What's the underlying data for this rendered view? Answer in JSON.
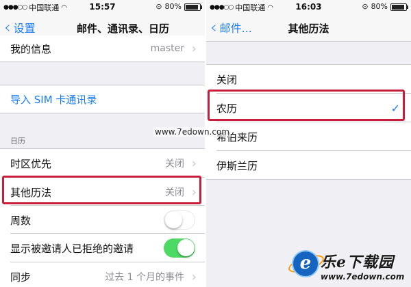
{
  "left": {
    "status": {
      "carrier": "中国联通",
      "time": "15:57",
      "battery": "80%",
      "battery_level": 0.8
    },
    "nav": {
      "back_label": "设置",
      "title": "邮件、通讯录、日历"
    },
    "my_info": {
      "label": "我的信息",
      "value": "master"
    },
    "import_sim": "导入 SIM 卡通讯录",
    "calendar_header": "日历",
    "timezone": {
      "label": "时区优先",
      "value": "关闭"
    },
    "other_calendars": {
      "label": "其他历法",
      "value": "关闭"
    },
    "week_numbers": {
      "label": "周数",
      "state": "off"
    },
    "show_declined": {
      "label": "显示被邀请人已拒绝的邀请",
      "state": "on"
    },
    "sync": {
      "label": "同步",
      "value": "过去 1 个月的事件"
    }
  },
  "right": {
    "status": {
      "carrier": "中国联通",
      "time": "16:03",
      "battery": "80%",
      "battery_level": 0.8
    },
    "nav": {
      "back_label": "邮件...",
      "title": "其他历法"
    },
    "options": [
      {
        "label": "关闭",
        "selected": false
      },
      {
        "label": "农历",
        "selected": true
      },
      {
        "label": "希伯来历",
        "selected": false
      },
      {
        "label": "伊斯兰历",
        "selected": false
      }
    ]
  },
  "watermark": {
    "center_text": "www.7edown.com",
    "logo_name": "乐e下载园",
    "logo_url": "www.7edown.com"
  },
  "colors": {
    "accent": "#1a7cf5",
    "highlight": "#c81e3c",
    "toggle_on": "#4cd964",
    "background": "#efeff4"
  },
  "icons": {
    "back": "chevron-left-icon",
    "disclosure": "chevron-right-icon",
    "check": "checkmark-icon",
    "wifi": "wifi-icon",
    "battery": "battery-icon",
    "lock": "orientation-lock-icon"
  }
}
